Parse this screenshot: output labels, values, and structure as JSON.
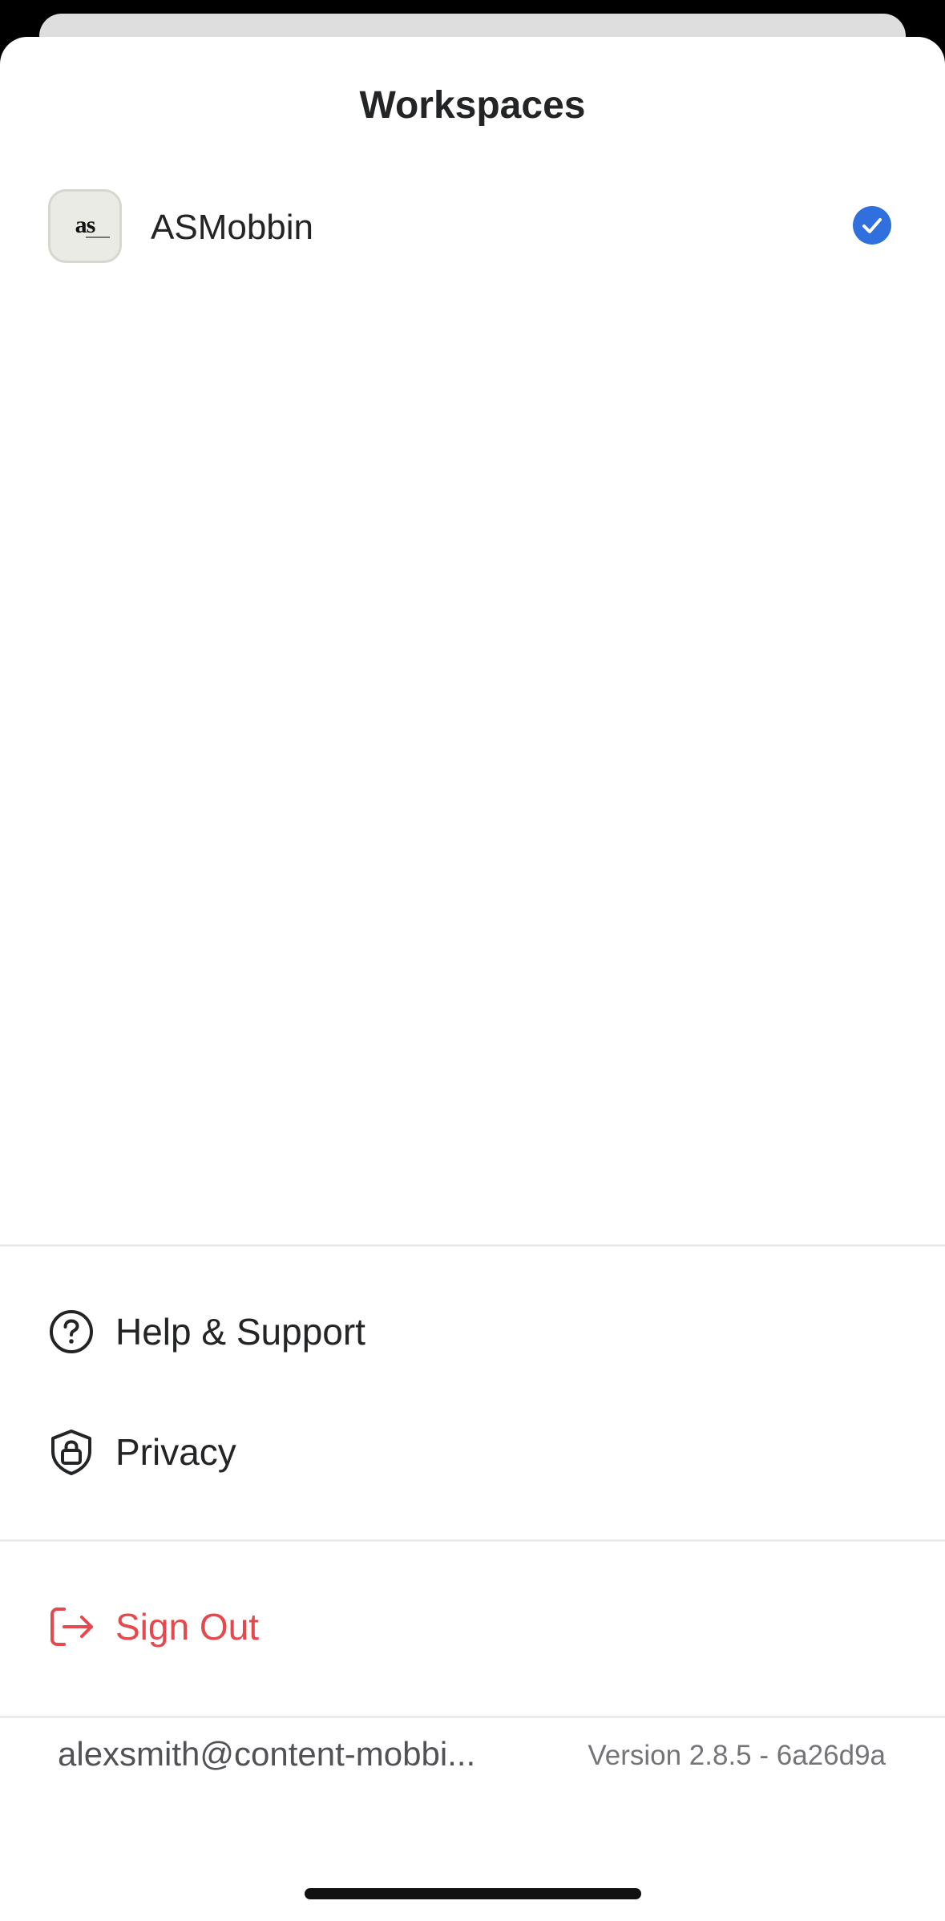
{
  "title": "Workspaces",
  "workspaces": [
    {
      "name": "ASMobbin",
      "logo_text": "as",
      "selected": true
    }
  ],
  "menu": {
    "help_label": "Help & Support",
    "privacy_label": "Privacy",
    "signout_label": "Sign Out"
  },
  "footer": {
    "email": "alexsmith@content-mobbi...",
    "version": "Version 2.8.5 - 6a26d9a"
  },
  "icons": {
    "help": "question-circle-icon",
    "privacy": "shield-lock-icon",
    "signout": "sign-out-arrow-icon",
    "selected": "checkmark-circle-icon"
  },
  "colors": {
    "accent": "#2f6fde",
    "danger": "#e5484d",
    "text": "#222426",
    "muted": "#737578"
  }
}
